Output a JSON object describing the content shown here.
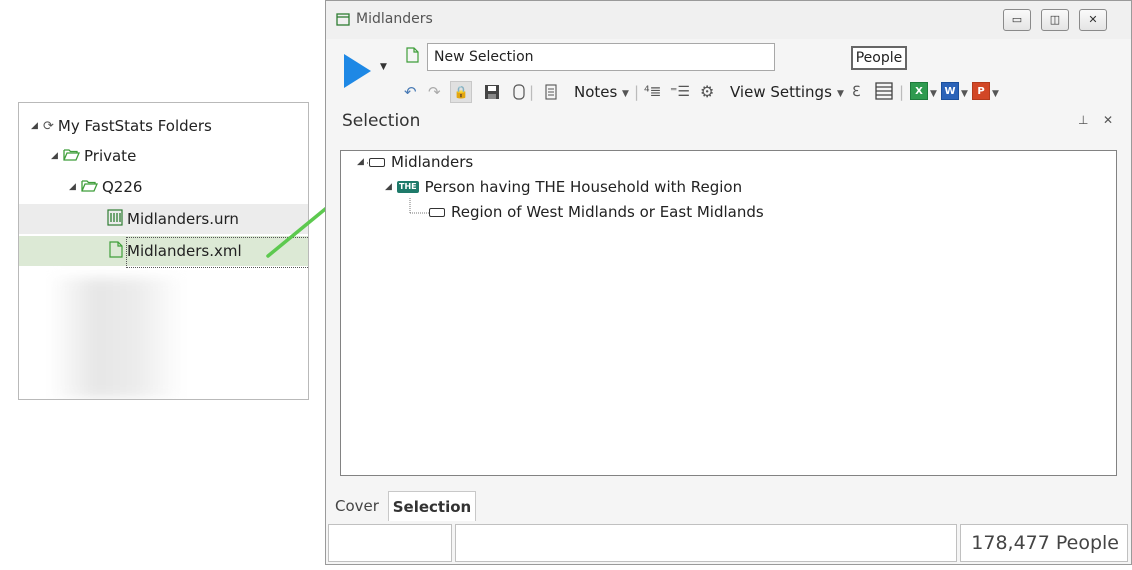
{
  "explorer": {
    "root": "My FastStats Folders",
    "folder_private": "Private",
    "folder_q226": "Q226",
    "file_urn": "Midlanders.urn",
    "file_xml": "Midlanders.xml"
  },
  "window": {
    "title": "Midlanders",
    "selection_name": "New Selection",
    "count_unit": "People",
    "notes_label": "Notes",
    "view_settings_label": "View Settings",
    "panel_title": "Selection",
    "tree": {
      "root": "Midlanders",
      "child_badge": "THE",
      "child": "Person having THE Household with Region",
      "leaf": "Region of West Midlands or East Midlands"
    },
    "tabs": [
      "Cover",
      "Selection"
    ],
    "status_count": "178,477 People"
  },
  "colors": {
    "accent_blue": "#1e88e5",
    "arrow_green": "#5dc94f",
    "selected_row": "#dce9d5"
  }
}
